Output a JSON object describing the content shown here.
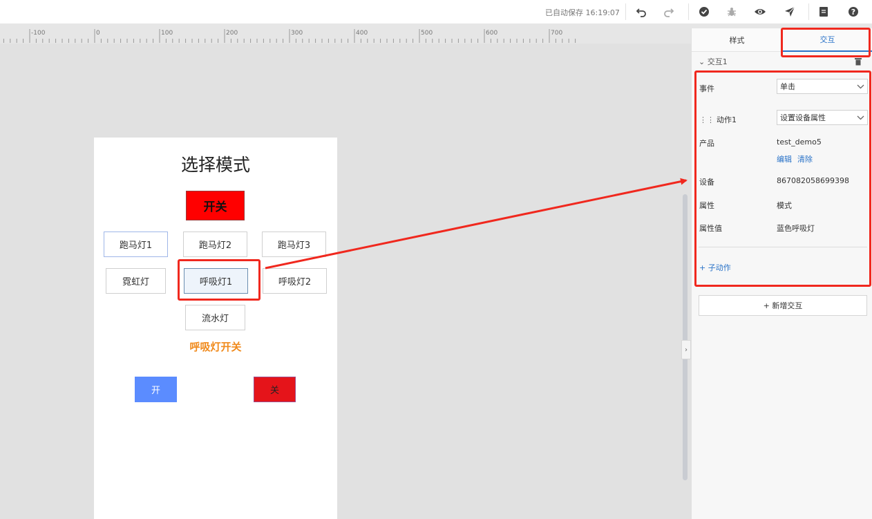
{
  "toolbar": {
    "autosave": "已自动保存 16:19:07",
    "icons": [
      "undo-icon",
      "redo-icon",
      "check-circle-icon",
      "bug-icon",
      "eye-icon",
      "send-icon",
      "document-icon",
      "help-icon"
    ]
  },
  "ruler": {
    "labels": [
      "-100",
      "0",
      "100",
      "200",
      "300",
      "400",
      "500",
      "600",
      "700"
    ]
  },
  "artboard": {
    "title": "选择模式",
    "switch_label": "开关",
    "mode_buttons": [
      "跑马灯1",
      "跑马灯2",
      "跑马灯3",
      "霓虹灯",
      "呼吸灯1",
      "呼吸灯2",
      "流水灯"
    ],
    "breath_label": "呼吸灯开关",
    "on_label": "开",
    "off_label": "关"
  },
  "panel": {
    "tabs": [
      "样式",
      "交互"
    ],
    "active_tab": "交互",
    "group": "交互1",
    "event_label": "事件",
    "event_value": "单击",
    "action_label": "动作1",
    "action_value": "设置设备属性",
    "product_label": "产品",
    "product_value": "test_demo5",
    "edit_link": "编辑",
    "clear_link": "清除",
    "device_label": "设备",
    "device_value": "867082058699398",
    "prop_label": "属性",
    "prop_value": "模式",
    "prop_val_label": "属性值",
    "prop_val_value": "蓝色呼吸灯",
    "sub_action": "+ 子动作",
    "add_interaction": "+ 新增交互"
  },
  "colors": {
    "accent": "#2a73c8",
    "highlight": "#f0281e",
    "switch_bg": "#ff0000",
    "on_bg": "#5b8cff",
    "off_bg": "#e5141a",
    "breath_text": "#f08a1c"
  }
}
